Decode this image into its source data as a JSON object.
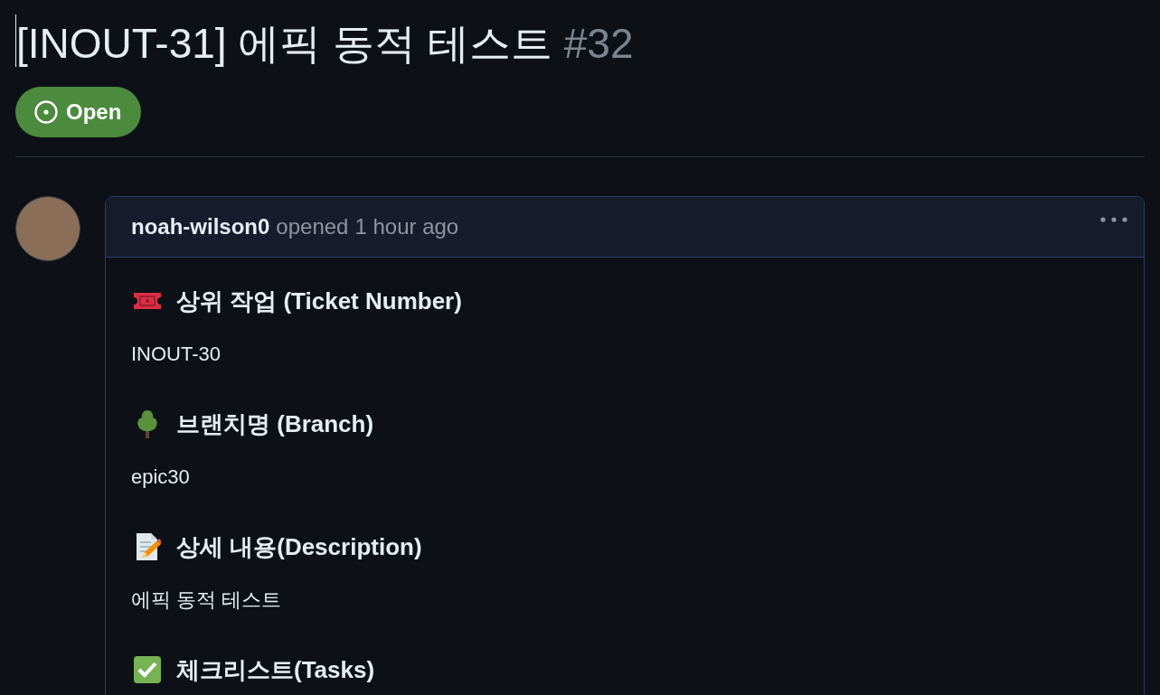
{
  "issue": {
    "title": "[INOUT-31] 에픽 동적 테스트",
    "number": "#32",
    "state": {
      "kind": "open",
      "label": "Open"
    }
  },
  "comment": {
    "author": "noah-wilson0",
    "action": "opened",
    "time": "1 hour ago",
    "sections": [
      {
        "kind": "ticket",
        "heading": "상위 작업 (Ticket Number)",
        "body": "INOUT-30"
      },
      {
        "kind": "tree",
        "heading": "브랜치명 (Branch)",
        "body": "epic30"
      },
      {
        "kind": "memo",
        "heading": "상세 내용(Description)",
        "body": "에픽 동적 테스트"
      },
      {
        "kind": "check",
        "heading": "체크리스트(Tasks)"
      }
    ]
  }
}
